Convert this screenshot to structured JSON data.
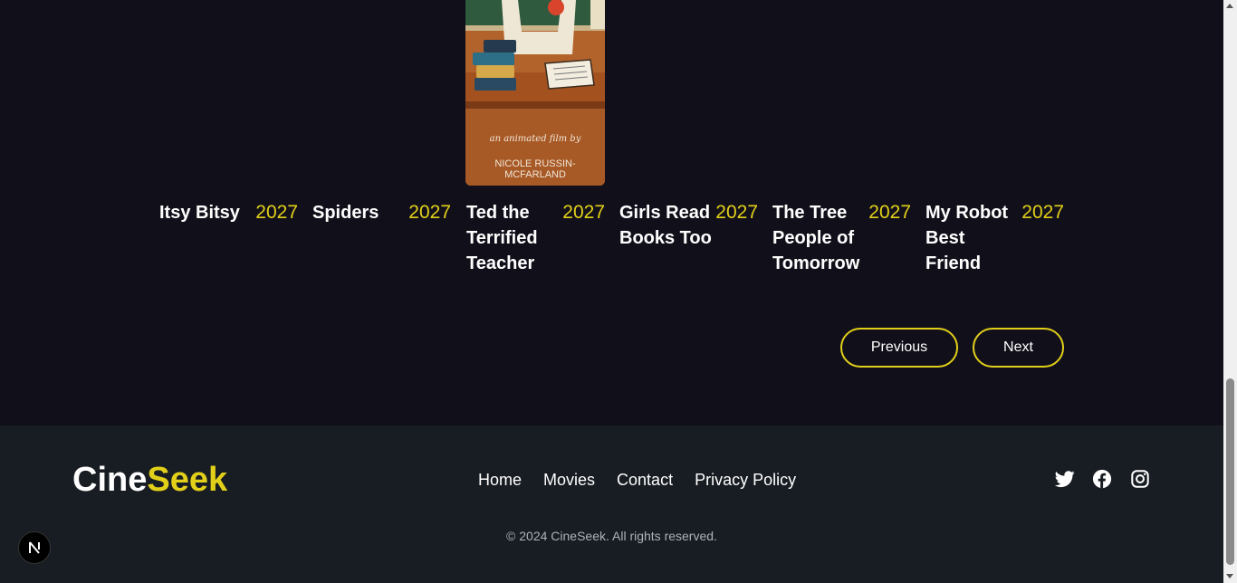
{
  "poster": {
    "caption_line1": "an animated film by",
    "caption_line2": "NICOLE RUSSIN-MCFARLAND"
  },
  "movies": [
    {
      "title": "Itsy Bitsy",
      "year": "2027"
    },
    {
      "title": "Spiders",
      "year": "2027"
    },
    {
      "title": "Ted the Terrified Teacher",
      "year": "2027"
    },
    {
      "title": "Girls Read Books Too",
      "year": "2027"
    },
    {
      "title": "The Tree People of Tomorrow",
      "year": "2027"
    },
    {
      "title": "My Robot Best Friend",
      "year": "2027"
    }
  ],
  "pagination": {
    "previous": "Previous",
    "next": "Next"
  },
  "footer": {
    "brand_part1": "Cine",
    "brand_part2": "Seek",
    "nav": [
      "Home",
      "Movies",
      "Contact",
      "Privacy Policy"
    ],
    "social": [
      "twitter-icon",
      "facebook-icon",
      "instagram-icon"
    ],
    "copyright": "© 2024 CineSeek. All rights reserved."
  },
  "colors": {
    "background": "#11101a",
    "footer_background": "#181d23",
    "accent": "#e2cf19",
    "text": "#ffffff",
    "muted_text": "#aeb2b8"
  }
}
